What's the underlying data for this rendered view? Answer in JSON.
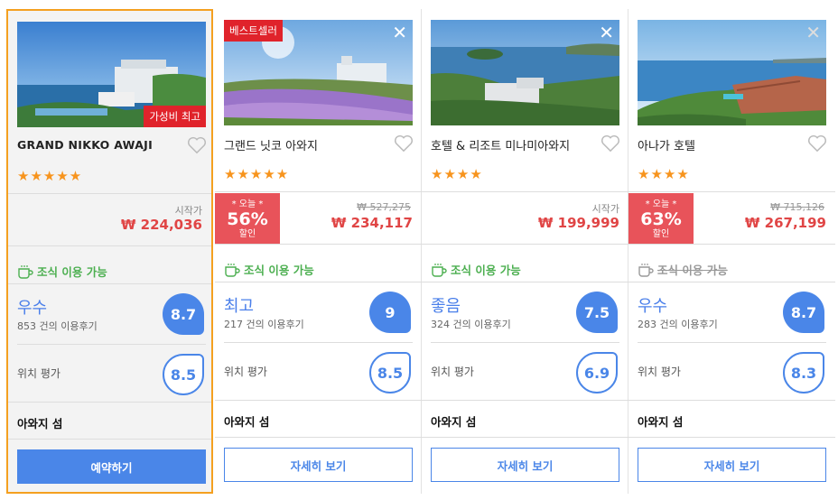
{
  "hotels": [
    {
      "name": "GRAND NIKKO AWAJI",
      "badge": "가성비 최고",
      "stars": "★★★★★",
      "price_prefix": "시작가",
      "price": "₩ 224,036",
      "breakfast": "조식 이용 가능",
      "rating_word": "우수",
      "review_count": "853 건의 이용후기",
      "score": "8.7",
      "location_label": "위치 평가",
      "location_score": "8.5",
      "area": "아와지 섬",
      "button": "예약하기"
    },
    {
      "name": "그랜드 닛코 아와지",
      "badge": "베스트셀러",
      "close": "✕",
      "stars": "★★★★★",
      "discount_top": "* 오늘 *",
      "discount_pct": "56%",
      "discount_bottom": "할인",
      "original_price": "₩ 527,275",
      "price": "₩ 234,117",
      "breakfast": "조식 이용 가능",
      "rating_word": "최고",
      "review_count": "217 건의 이용후기",
      "score": "9",
      "location_label": "위치 평가",
      "location_score": "8.5",
      "area": "아와지 섬",
      "button": "자세히 보기"
    },
    {
      "name": "호텔 & 리조트 미나미아와지",
      "close": "✕",
      "stars": "★★★★",
      "price_prefix": "시작가",
      "price": "₩ 199,999",
      "breakfast": "조식 이용 가능",
      "rating_word": "좋음",
      "review_count": "324 건의 이용후기",
      "score": "7.5",
      "location_label": "위치 평가",
      "location_score": "6.9",
      "area": "아와지 섬",
      "button": "자세히 보기"
    },
    {
      "name": "아나가 호텔",
      "close": "✕",
      "stars": "★★★★",
      "discount_top": "* 오늘 *",
      "discount_pct": "63%",
      "discount_bottom": "할인",
      "original_price": "₩ 715,126",
      "price": "₩ 267,199",
      "breakfast": "조식 이용 가능",
      "rating_word": "우수",
      "review_count": "283 건의 이용후기",
      "score": "8.7",
      "location_label": "위치 평가",
      "location_score": "8.3",
      "area": "아와지 섬",
      "button": "자세히 보기"
    }
  ],
  "colors": {
    "accent": "#4a86e8",
    "price": "#e04545",
    "badge": "#e0232b",
    "discount": "#e8535a",
    "selected_border": "#f4a020",
    "breakfast": "#4caf50",
    "stars": "#f7941d"
  }
}
